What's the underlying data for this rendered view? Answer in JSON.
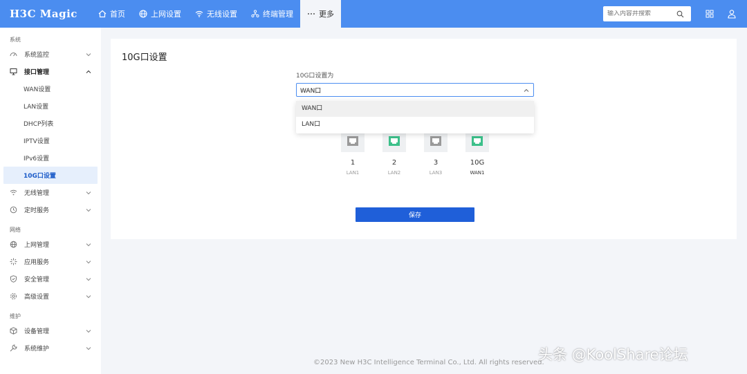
{
  "header": {
    "logo": "H3C Magic",
    "nav": [
      {
        "label": "首页",
        "icon": "home-icon"
      },
      {
        "label": "上网设置",
        "icon": "globe-icon"
      },
      {
        "label": "无线设置",
        "icon": "wifi-icon"
      },
      {
        "label": "终端管理",
        "icon": "devices-icon"
      },
      {
        "label": "更多",
        "icon": "more-icon"
      }
    ],
    "search_placeholder": "输入内容并搜索"
  },
  "sidebar": {
    "groups": [
      {
        "title": "系统"
      },
      {
        "title": "网络"
      },
      {
        "title": "维护"
      }
    ],
    "items": {
      "monitor": "系统监控",
      "interface": "接口管理",
      "wan": "WAN设置",
      "lan": "LAN设置",
      "dhcp": "DHCP列表",
      "iptv": "IPTV设置",
      "ipv6": "IPv6设置",
      "tenG": "10G口设置",
      "wireless": "无线管理",
      "timer": "定时服务",
      "internet": "上网管理",
      "apps": "应用服务",
      "security": "安全管理",
      "advanced": "高级设置",
      "device": "设备管理",
      "maintain": "系统维护"
    }
  },
  "main": {
    "title": "10G口设置",
    "field_label": "10G口设置为",
    "selected": "WAN口",
    "options": [
      "WAN口",
      "LAN口"
    ],
    "ports": [
      {
        "num": "1",
        "type": "LAN1",
        "active": false
      },
      {
        "num": "2",
        "type": "LAN2",
        "active": true
      },
      {
        "num": "3",
        "type": "LAN3",
        "active": false
      },
      {
        "num": "10G",
        "type": "WAN1",
        "active": true
      }
    ],
    "save_label": "保存"
  },
  "footer": "©2023 New H3C Intelligence Terminal Co., Ltd. All rights reserved.",
  "watermark": "头条 @KoolShare论坛",
  "colors": {
    "accent": "#4b8df0",
    "button": "#1f5fd9",
    "port_active": "#3cc08a",
    "port_inactive": "#9a9a9a"
  }
}
